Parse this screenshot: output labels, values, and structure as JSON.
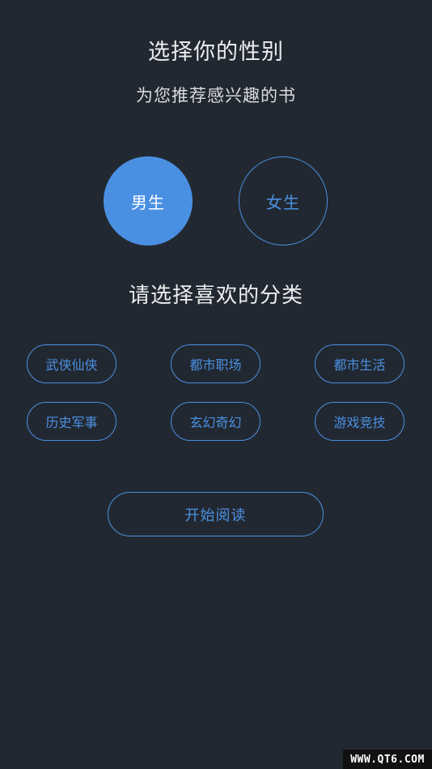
{
  "header": {
    "title": "选择你的性别",
    "subtitle": "为您推荐感兴趣的书"
  },
  "gender": {
    "male_label": "男生",
    "female_label": "女生",
    "selected": "male"
  },
  "categories": {
    "title": "请选择喜欢的分类",
    "items": [
      "武侠仙侠",
      "都市职场",
      "都市生活",
      "历史军事",
      "玄幻奇幻",
      "游戏竞技"
    ]
  },
  "actions": {
    "start_label": "开始阅读"
  },
  "watermark": {
    "text": "WWW.QT6.COM"
  },
  "colors": {
    "background": "#222831",
    "accent": "#4a90e2"
  }
}
